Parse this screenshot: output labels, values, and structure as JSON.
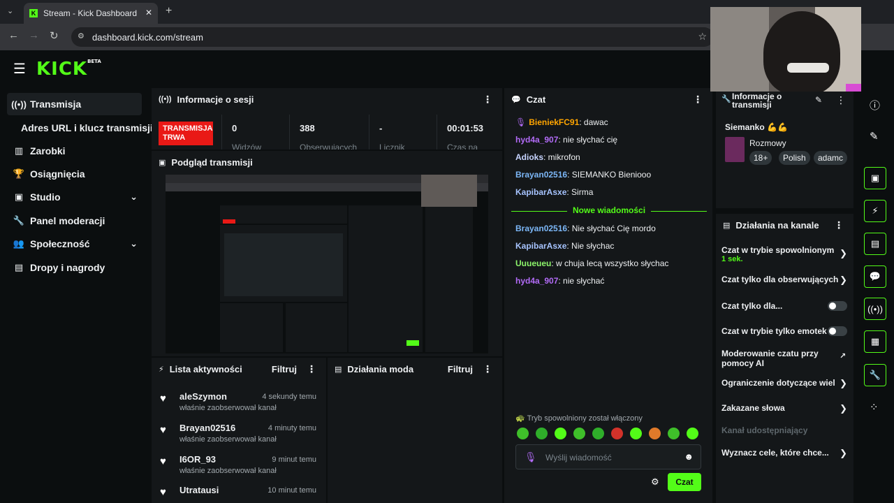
{
  "browser": {
    "tab_title": "Stream - Kick Dashboard",
    "url": "dashboard.kick.com/stream"
  },
  "app": {
    "logo": "KICK",
    "logo_badge": "BETA"
  },
  "sidebar": {
    "items": [
      {
        "label": "Transmisja",
        "icon": "broadcast-icon"
      },
      {
        "label": "Adres URL i klucz transmisji",
        "icon": ""
      },
      {
        "label": "Zarobki",
        "icon": "chart-icon"
      },
      {
        "label": "Osiągnięcia",
        "icon": "trophy-icon"
      },
      {
        "label": "Studio",
        "icon": "studio-icon"
      },
      {
        "label": "Panel moderacji",
        "icon": "wrench-icon"
      },
      {
        "label": "Społeczność",
        "icon": "people-icon"
      },
      {
        "label": "Dropy i nagrody",
        "icon": "gift-icon"
      }
    ]
  },
  "session": {
    "title": "Informacje o sesji",
    "live_badge": "TRANSMISJA TRWA",
    "stats": [
      {
        "value": "0",
        "label": "Widzów"
      },
      {
        "value": "388",
        "label": "Obserwujących"
      },
      {
        "value": "-",
        "label": "Licznik"
      },
      {
        "value": "00:01:53",
        "label": "Czas na"
      }
    ]
  },
  "preview": {
    "title": "Podgląd transmisji"
  },
  "activity": {
    "title": "Lista aktywności",
    "filter": "Filtruj",
    "items": [
      {
        "name": "aleSzymon",
        "time": "4 sekundy temu",
        "desc": "właśnie zaobserwował kanał"
      },
      {
        "name": "Brayan02516",
        "time": "4 minuty temu",
        "desc": "właśnie zaobserwował kanał"
      },
      {
        "name": "I6OR_93",
        "time": "9 minut temu",
        "desc": "właśnie zaobserwował kanał"
      },
      {
        "name": "Utratausi",
        "time": "10 minut temu",
        "desc": ""
      }
    ]
  },
  "mod": {
    "title": "Działania moda",
    "filter": "Filtruj"
  },
  "chat": {
    "title": "Czat",
    "messages_before": [
      {
        "user": "BieniekFC91",
        "text": ": dawac",
        "color": "#ffa500"
      },
      {
        "user": "hyd4a_907",
        "text": ": nie słychać cię",
        "color": "#b26bf7"
      },
      {
        "user": "Adioks",
        "text": ": mikrofon",
        "color": "#c7d4ff"
      },
      {
        "user": "Brayan02516",
        "text": ": SIEMANKO Bieniooo",
        "color": "#7cb7f7"
      },
      {
        "user": "KapibarAsxe",
        "text": ": Sirma",
        "color": "#a7c4ff"
      }
    ],
    "new_messages_label": "Nowe wiadomości",
    "messages_after": [
      {
        "user": "Brayan02516",
        "text": ": Nie słychać Cię mordo",
        "color": "#7cb7f7"
      },
      {
        "user": "KapibarAsxe",
        "text": ": Nie słychac",
        "color": "#a7c4ff"
      },
      {
        "user": "Uuueueu",
        "text": ": w chuja lecą wszystko słychac",
        "color": "#8df56b"
      },
      {
        "user": "hyd4a_907",
        "text": ": nie słychać",
        "color": "#b26bf7"
      }
    ],
    "slow_mode_notice": "Tryb spowolniony został włączony",
    "placeholder": "Wyślij wiadomość",
    "send_button": "Czat"
  },
  "stream_info": {
    "title": "Informacje o transmisji",
    "stream_title": "Siemanko 💪💪",
    "category": "Rozmowy",
    "tags": [
      "18+",
      "Polish",
      "adamc"
    ]
  },
  "channel_actions": {
    "title": "Działania na kanale",
    "items": [
      {
        "label": "Czat w trybie spowolnionym",
        "sub": "1 sek.",
        "type": "chevron"
      },
      {
        "label": "Czat tylko dla obserwujących",
        "sub": "",
        "type": "chevron"
      },
      {
        "label": "Czat tylko dla...",
        "sub": "",
        "type": "toggle"
      },
      {
        "label": "Czat w trybie tylko emotek",
        "sub": "",
        "type": "toggle"
      },
      {
        "label": "Moderowanie czatu przy pomocy AI",
        "sub": "",
        "type": "external"
      },
      {
        "label": "Ograniczenie dotyczące wiel",
        "sub": "",
        "type": "chevron"
      },
      {
        "label": "Zakazane słowa",
        "sub": "",
        "type": "chevron"
      },
      {
        "label": "Kanał udostępniający",
        "sub": "",
        "type": "disabled"
      },
      {
        "label": "Wyznacz cele, które chce...",
        "sub": "",
        "type": "chevron"
      }
    ]
  },
  "colors": {
    "accent": "#53fc18",
    "live": "#e91916",
    "panel": "#141719",
    "background": "#0b0e0f"
  }
}
